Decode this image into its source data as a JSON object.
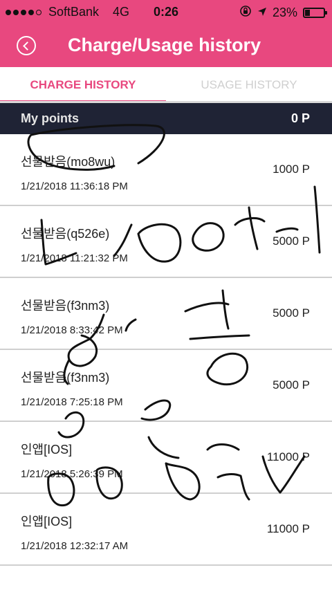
{
  "status_bar": {
    "carrier": "SoftBank",
    "network": "4G",
    "time": "0:26",
    "battery": "23%"
  },
  "header": {
    "title": "Charge/Usage history"
  },
  "tabs": [
    {
      "label": "CHARGE HISTORY"
    },
    {
      "label": "USAGE HISTORY"
    }
  ],
  "points": {
    "label": "My points",
    "value": "0 P"
  },
  "history": [
    {
      "name": "선물받음(mo8wu)",
      "date": "1/21/2018 11:36:18 PM",
      "amount": "1000 P"
    },
    {
      "name": "선물받음(q526e)",
      "date": "1/21/2018 11:21:32 PM",
      "amount": "5000 P"
    },
    {
      "name": "선물받음(f3nm3)",
      "date": "1/21/2018 8:33:42 PM",
      "amount": "5000 P"
    },
    {
      "name": "선물받음(f3nm3)",
      "date": "1/21/2018 7:25:18 PM",
      "amount": "5000 P"
    },
    {
      "name": "인앱[IOS]",
      "date": "1/21/2018 5:26:39 PM",
      "amount": "11000 P"
    },
    {
      "name": "인앱[IOS]",
      "date": "1/21/2018 12:32:17 AM",
      "amount": "11000 P"
    }
  ]
}
